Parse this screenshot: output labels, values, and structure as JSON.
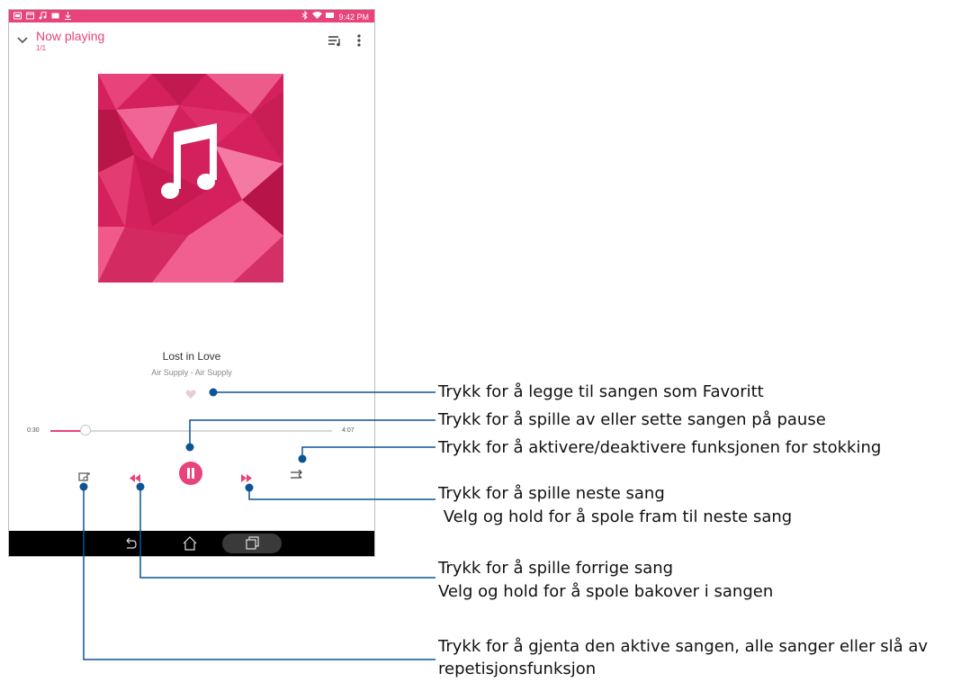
{
  "status_bar": {
    "time": "9:42 PM",
    "left_icons": [
      "gallery-icon",
      "calendar-icon",
      "music-note-icon",
      "image-icon",
      "download-icon"
    ],
    "right_icons": [
      "bluetooth-icon",
      "wifi-icon",
      "battery-icon"
    ]
  },
  "header": {
    "title": "Now playing",
    "count": "1/1"
  },
  "song": {
    "title": "Lost in Love",
    "artist_album": "Air Supply - Air Supply"
  },
  "progress": {
    "current": "0:30",
    "total": "4:07",
    "fraction": 0.121
  },
  "controls": [
    "repeat-icon",
    "rewind-icon",
    "pause-icon",
    "fast-forward-icon",
    "shuffle-icon"
  ],
  "nav": [
    "back-icon",
    "home-icon",
    "recents-icon"
  ],
  "colors": {
    "accent": "#e8437a",
    "callout_line": "#0d5494"
  },
  "callouts": {
    "favorite": "Trykk for å legge til sangen som Favoritt",
    "play_pause": "Trykk for å spille av eller sette sangen på pause",
    "shuffle": "Trykk for å aktivere/deaktivere funksjonen for stokking",
    "next_line1": "Trykk for å spille neste sang",
    "next_line2": " Velg og hold for å spole fram til neste sang",
    "prev_line1": "Trykk for å spille forrige sang",
    "prev_line2": "Velg og hold for å spole bakover i sangen",
    "repeat_line1": "Trykk for å gjenta den aktive sangen, alle sanger eller slå av",
    "repeat_line2": "repetisjonsfunksjon"
  }
}
